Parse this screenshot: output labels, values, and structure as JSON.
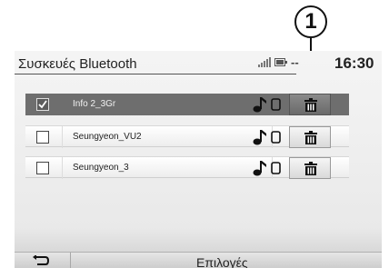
{
  "callout": {
    "label": "1"
  },
  "header": {
    "title": "Συσκευές Bluetooth",
    "status_dashes": "-- ",
    "clock": "16:30"
  },
  "devices": [
    {
      "name": "Info 2_3Gr",
      "checked": true
    },
    {
      "name": "Seungyeon_VU2",
      "checked": false
    },
    {
      "name": "Seungyeon_3",
      "checked": false
    }
  ],
  "icons": {
    "audio": "music-note-icon",
    "phone": "phone-icon",
    "delete": "trash-icon",
    "back": "back-arrow-icon",
    "signal": "signal-icon",
    "battery": "battery-icon",
    "checkbox": "checkmark-icon"
  },
  "footer": {
    "options_label": "Επιλογές"
  },
  "colors": {
    "selected_row": "#6e6e6e",
    "text": "#222222"
  }
}
